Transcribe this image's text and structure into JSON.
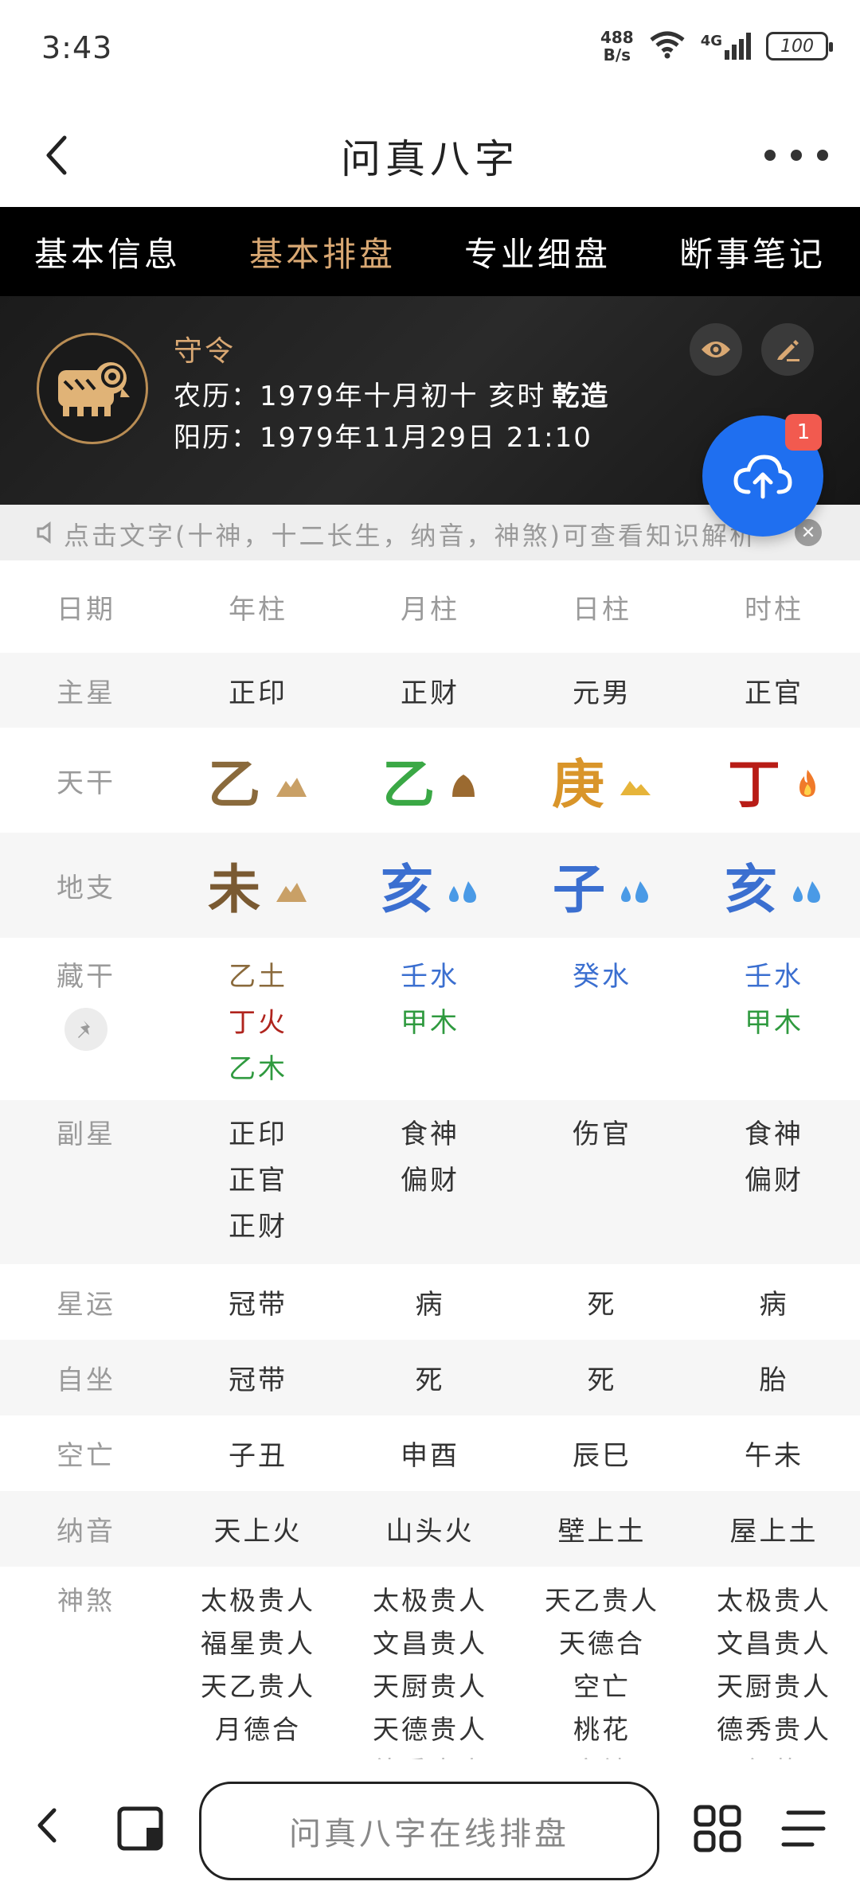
{
  "status": {
    "time": "3:43",
    "net_speed_value": "488",
    "net_speed_unit": "B/s",
    "network": "4G",
    "battery": "100"
  },
  "header": {
    "title": "问真八字"
  },
  "tabs": [
    {
      "label": "基本信息",
      "active": false
    },
    {
      "label": "基本排盘",
      "active": true
    },
    {
      "label": "专业细盘",
      "active": false
    },
    {
      "label": "断事笔记",
      "active": false
    }
  ],
  "profile": {
    "name": "守令",
    "lunar": "农历：1979年十月初十 亥时",
    "gender": "乾造",
    "solar": "阳历：1979年11月29日 21:10"
  },
  "fab_badge": "1",
  "notice": "点击文字(十神，十二长生，纳音，神煞)可查看知识解析",
  "table": {
    "headers": [
      "日期",
      "年柱",
      "月柱",
      "日柱",
      "时柱"
    ],
    "main_star": {
      "label": "主星",
      "values": [
        "正印",
        "正财",
        "元男",
        "正官"
      ]
    },
    "heavenly": {
      "label": "天干",
      "chars": [
        "乙",
        "乙",
        "庚",
        "丁"
      ],
      "elements": [
        "earth",
        "earth",
        "metal",
        "fire"
      ]
    },
    "earthly": {
      "label": "地支",
      "chars": [
        "未",
        "亥",
        "子",
        "亥"
      ],
      "elements": [
        "earth",
        "water",
        "water",
        "water"
      ]
    },
    "hidden": {
      "label": "藏干",
      "values": [
        [
          "乙土",
          "丁火",
          "乙木"
        ],
        [
          "壬水",
          "甲木"
        ],
        [
          "癸水"
        ],
        [
          "壬水",
          "甲木"
        ]
      ]
    },
    "sub_star": {
      "label": "副星",
      "values": [
        [
          "正印",
          "正官",
          "正财"
        ],
        [
          "食神",
          "偏财"
        ],
        [
          "伤官"
        ],
        [
          "食神",
          "偏财"
        ]
      ]
    },
    "star_luck": {
      "label": "星运",
      "values": [
        "冠带",
        "病",
        "死",
        "病"
      ]
    },
    "self_sit": {
      "label": "自坐",
      "values": [
        "冠带",
        "死",
        "死",
        "胎"
      ]
    },
    "void": {
      "label": "空亡",
      "values": [
        "子丑",
        "申酉",
        "辰巳",
        "午未"
      ]
    },
    "nayin": {
      "label": "纳音",
      "values": [
        "天上火",
        "山头火",
        "壁上土",
        "屋上土"
      ]
    },
    "shensha": {
      "label": "神煞",
      "values": [
        [
          "太极贵人",
          "福星贵人",
          "天乙贵人",
          "月德合"
        ],
        [
          "太极贵人",
          "文昌贵人",
          "天厨贵人",
          "天德贵人",
          "德秀贵人"
        ],
        [
          "天乙贵人",
          "天德合",
          "空亡",
          "桃花",
          "亡神"
        ],
        [
          "太极贵人",
          "文昌贵人",
          "天厨贵人",
          "德秀贵人",
          "红艳"
        ]
      ]
    }
  },
  "bottom": {
    "search_label": "问真八字在线排盘"
  },
  "colors": {
    "tab_active": "#d9a873",
    "fab": "#1f6ff0",
    "badge": "#f25a4f",
    "shensha": "#b8975a"
  }
}
